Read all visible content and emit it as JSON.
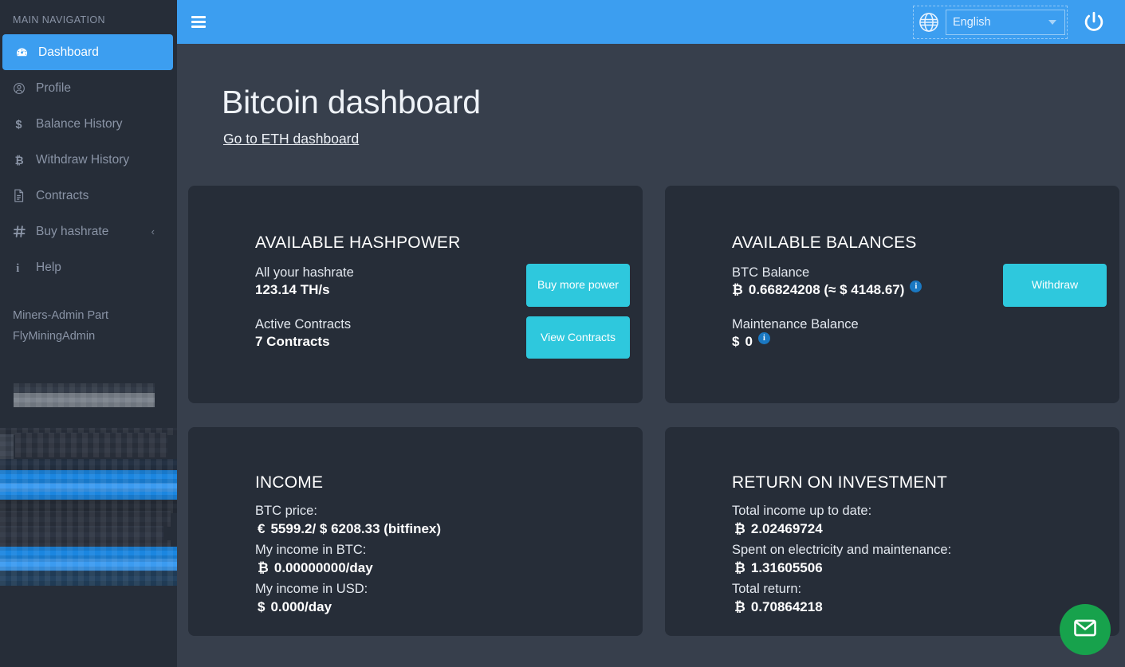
{
  "sidebar": {
    "heading": "MAIN NAVIGATION",
    "items": [
      {
        "label": "Dashboard",
        "icon": "dashboard-icon"
      },
      {
        "label": "Profile",
        "icon": "user-circle-icon"
      },
      {
        "label": "Balance History",
        "icon": "dollar-icon"
      },
      {
        "label": "Withdraw History",
        "icon": "bitcoin-icon"
      },
      {
        "label": "Contracts",
        "icon": "document-icon"
      },
      {
        "label": "Buy hashrate",
        "icon": "hash-icon",
        "chevron": "‹"
      },
      {
        "label": "Help",
        "icon": "info-icon"
      }
    ],
    "admin_section": "Miners-Admin Part",
    "admin_user": "FlyMiningAdmin"
  },
  "topbar": {
    "menu_icon": "hamburger-icon",
    "globe_icon": "globe-icon",
    "language": "English",
    "power_icon": "power-icon"
  },
  "page": {
    "title": "Bitcoin dashboard",
    "sublink": "Go to ETH dashboard"
  },
  "cards": {
    "hashpower": {
      "title": "AVAILABLE HASHPOWER",
      "hashrate_label": "All your hashrate",
      "hashrate_value": "123.14 TH/s",
      "contracts_label": "Active Contracts",
      "contracts_value": "7 Contracts",
      "buy_button": "Buy more power",
      "view_button": "View Contracts"
    },
    "balances": {
      "title": "AVAILABLE BALANCES",
      "btc_label": "BTC Balance",
      "btc_symbol": "₿",
      "btc_value": "0.66824208 (≈ $ 4148.67)",
      "maint_label": "Maintenance Balance",
      "maint_symbol": "$",
      "maint_value": "0",
      "withdraw_button": "Withdraw",
      "info_glyph": "i"
    },
    "income": {
      "title": "INCOME",
      "rows": [
        {
          "key": "BTC price:",
          "symbol": "€",
          "value": "5599.2/ $ 6208.33 (bitfinex)"
        },
        {
          "key": "My income in BTC:",
          "symbol": "₿",
          "value": "0.00000000/day"
        },
        {
          "key": "My income in USD:",
          "symbol": "$",
          "value": "0.000/day"
        }
      ]
    },
    "roi": {
      "title": "RETURN ON INVESTMENT",
      "rows": [
        {
          "key": "Total income up to date:",
          "symbol": "₿",
          "value": "2.02469724"
        },
        {
          "key": "Spent on electricity and maintenance:",
          "symbol": "₿",
          "value": "1.31605506"
        },
        {
          "key": "Total return:",
          "symbol": "₿",
          "value": "0.70864218"
        }
      ]
    }
  },
  "chat": {
    "icon": "envelope-icon"
  },
  "colors": {
    "accent_blue": "#3c9ef0",
    "accent_cyan": "#2ec8dd",
    "card_bg": "#262d38",
    "page_bg": "#373f4c",
    "sidebar_bg": "#262d38",
    "chat_green": "#17a24c",
    "info_blue": "#1a78c2"
  }
}
